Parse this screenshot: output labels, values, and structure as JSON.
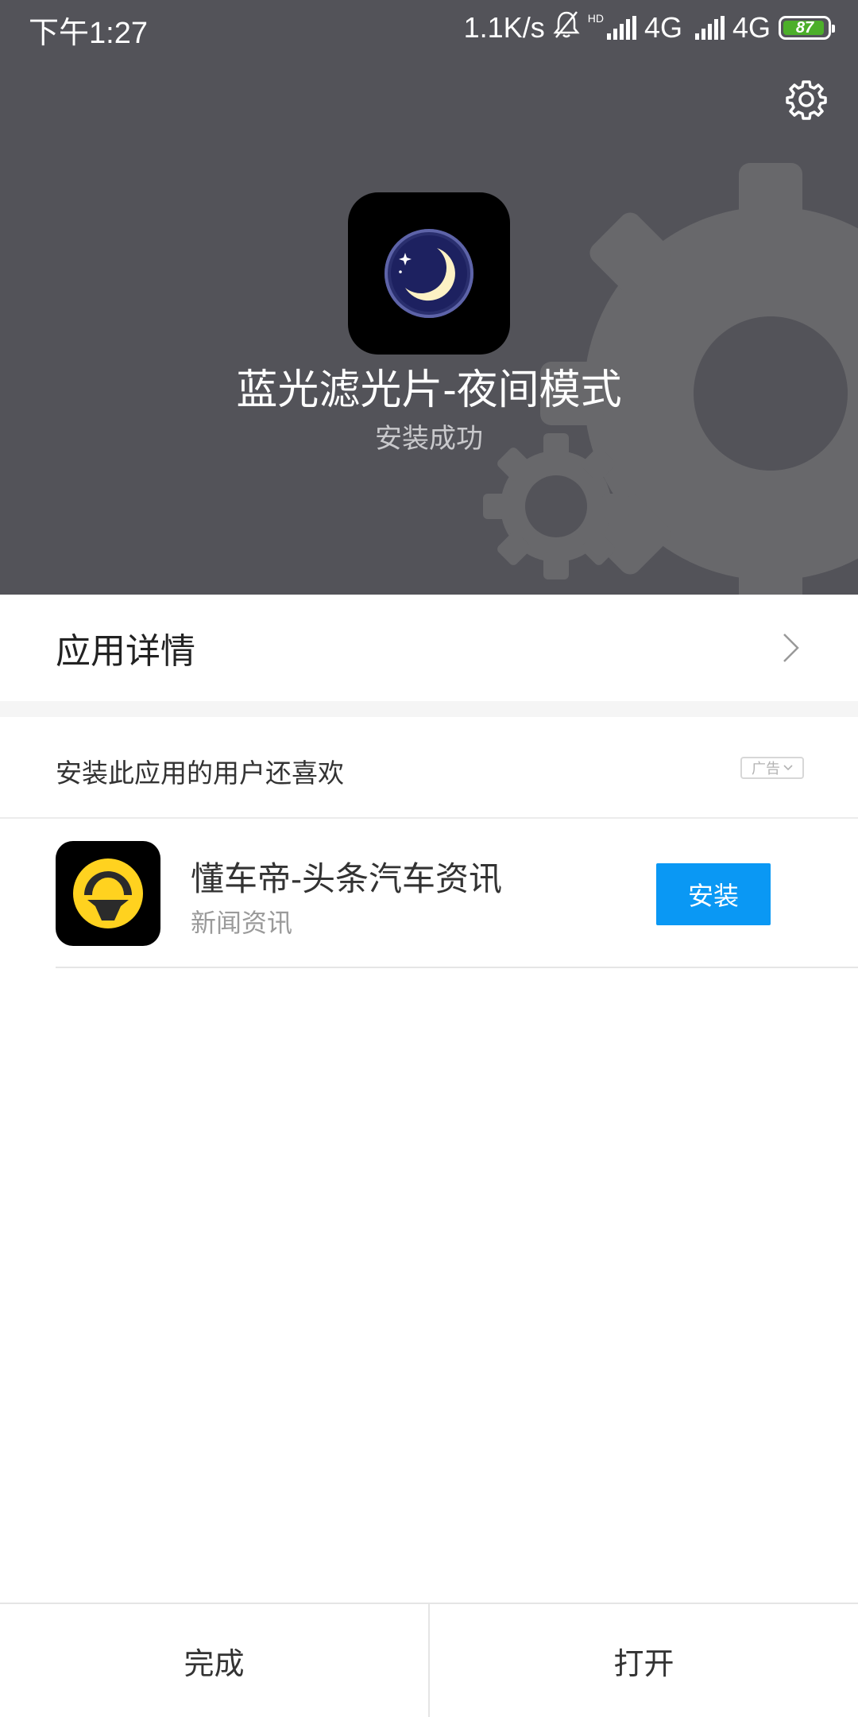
{
  "status_bar": {
    "time": "下午1:27",
    "net_speed": "1.1K/s",
    "hd_label": "HD",
    "network_1": "4G",
    "network_2": "4G",
    "battery_level": "87",
    "icons": [
      "bell-off-icon",
      "signal-icon",
      "battery-icon"
    ]
  },
  "header": {
    "settings_icon": "gear-icon",
    "app_name": "蓝光滤光片-夜间模式",
    "install_status": "安装成功",
    "app_icon": "moon-icon",
    "colors": {
      "background": "#535359",
      "gear_decoration": "#68686b"
    }
  },
  "app_details": {
    "label": "应用详情",
    "icon": "chevron-right-icon"
  },
  "recommendations": {
    "title": "安装此应用的用户还喜欢",
    "ad_label": "广告",
    "items": [
      {
        "name": "懂车帝-头条汽车资讯",
        "category": "新闻资讯",
        "icon": "steering-wheel-icon",
        "button_label": "安装"
      }
    ]
  },
  "bottom_bar": {
    "done_label": "完成",
    "open_label": "打开"
  },
  "colors": {
    "accent": "#0a98f4",
    "battery_fill": "#4caf2a"
  }
}
